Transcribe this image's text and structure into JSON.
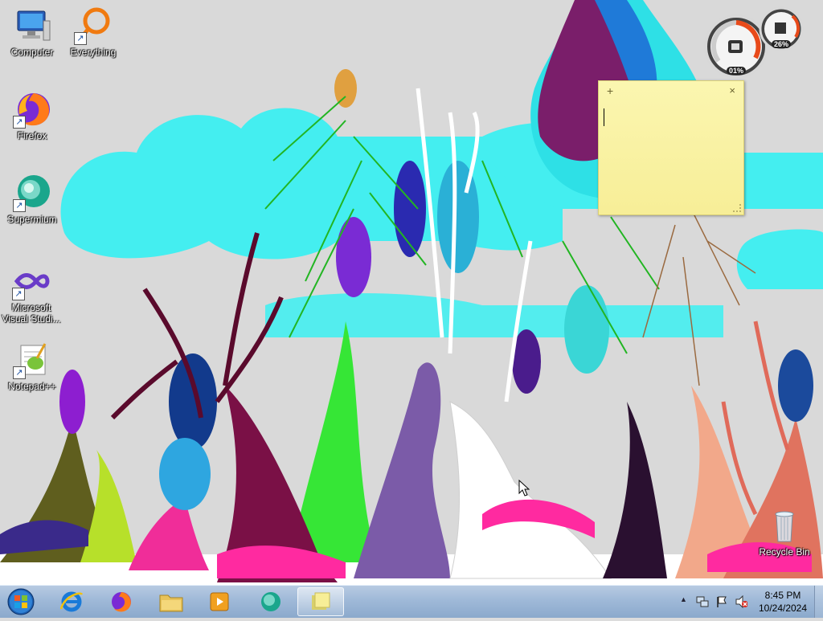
{
  "desktop": {
    "icons": [
      {
        "label": "Computer",
        "icon": "computer-icon"
      },
      {
        "label": "Everything",
        "icon": "everything-icon"
      },
      {
        "label": "Firefox",
        "icon": "firefox-icon"
      },
      {
        "label": "Supermium",
        "icon": "supermium-icon"
      },
      {
        "label": "Microsoft Visual Studi...",
        "icon": "visual-studio-icon"
      },
      {
        "label": "Notepad++",
        "icon": "notepadpp-icon"
      },
      {
        "label": "Recycle Bin",
        "icon": "recycle-bin-icon"
      }
    ]
  },
  "gadget": {
    "cpu_percent": "01%",
    "memory_percent": "26%"
  },
  "sticky_note": {
    "add_symbol": "+",
    "close_symbol": "×",
    "text": ""
  },
  "taskbar": {
    "pinned": [
      "start-orb",
      "internet-explorer-icon",
      "firefox-icon",
      "file-explorer-icon",
      "media-player-icon",
      "supermium-icon",
      "sticky-notes-icon"
    ],
    "tray_expand": "▲",
    "clock_time": "8:45 PM",
    "clock_date": "10/24/2024"
  },
  "colors": {
    "taskbar": "#9fb9d8",
    "sticky": "#f7ee97",
    "sky_cloud": "#3ff0f0"
  }
}
